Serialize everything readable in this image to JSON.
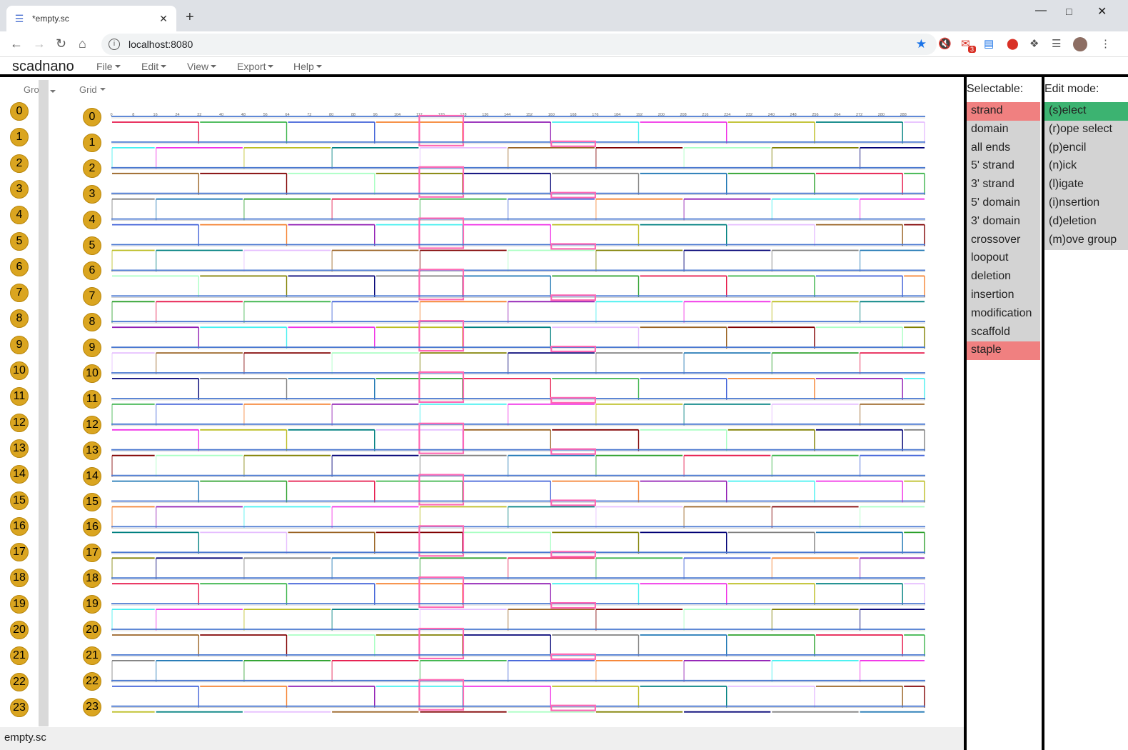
{
  "browser": {
    "tab_title": "*empty.sc",
    "url": "localhost:8080",
    "notif_count": "3"
  },
  "menubar": {
    "brand": "scadnano",
    "menus": [
      "File",
      "Edit",
      "View",
      "Export",
      "Help"
    ]
  },
  "sidebar_header": {
    "group": "Gro",
    "grid": "Grid"
  },
  "helix_indices": [
    "0",
    "1",
    "2",
    "3",
    "4",
    "5",
    "6",
    "7",
    "8",
    "9",
    "10",
    "11",
    "12",
    "13",
    "14",
    "15",
    "16",
    "17",
    "18",
    "19",
    "20",
    "21",
    "22",
    "23"
  ],
  "ruler_ticks": [
    "0",
    "8",
    "16",
    "24",
    "32",
    "40",
    "48",
    "56",
    "64",
    "72",
    "80",
    "88",
    "96",
    "104",
    "112",
    "120",
    "128",
    "136",
    "144",
    "152",
    "160",
    "168",
    "176",
    "184",
    "192",
    "200",
    "208",
    "216",
    "224",
    "232",
    "240",
    "248",
    "256",
    "264",
    "272",
    "280",
    "288"
  ],
  "selectable": {
    "header": "Selectable:",
    "options": [
      {
        "label": "strand",
        "selected": true
      },
      {
        "label": "domain",
        "selected": false
      },
      {
        "label": "all ends",
        "selected": false
      },
      {
        "label": "5' strand",
        "selected": false
      },
      {
        "label": "3' strand",
        "selected": false
      },
      {
        "label": "5' domain",
        "selected": false
      },
      {
        "label": "3' domain",
        "selected": false
      },
      {
        "label": "crossover",
        "selected": false
      },
      {
        "label": "loopout",
        "selected": false
      },
      {
        "label": "deletion",
        "selected": false
      },
      {
        "label": "insertion",
        "selected": false
      },
      {
        "label": "modification",
        "selected": false
      },
      {
        "label": "scaffold",
        "selected": false
      },
      {
        "label": "staple",
        "selected": true
      }
    ]
  },
  "edit_mode": {
    "header": "Edit mode:",
    "options": [
      {
        "label": "(s)elect",
        "selected": true
      },
      {
        "label": "(r)ope select",
        "selected": false
      },
      {
        "label": "(p)encil",
        "selected": false
      },
      {
        "label": "(n)ick",
        "selected": false
      },
      {
        "label": "(l)igate",
        "selected": false
      },
      {
        "label": "(i)nsertion",
        "selected": false
      },
      {
        "label": "(d)eletion",
        "selected": false
      },
      {
        "label": "(m)ove group",
        "selected": false
      }
    ]
  },
  "footer": {
    "filename": "empty.sc"
  },
  "colors": {
    "helix_circle": "#daa520",
    "scaffold": "#ff69b4",
    "selected_option": "#f08080",
    "active_mode": "#3cb371",
    "staple_palette": [
      "#e6194b",
      "#3cb44b",
      "#4363d8",
      "#f58231",
      "#911eb4",
      "#46f0f0",
      "#f032e6",
      "#bcbd22",
      "#008080",
      "#e6beff",
      "#9a6324",
      "#800000",
      "#aaffc3",
      "#808000",
      "#000075",
      "#808080",
      "#1f77b4",
      "#2ca02c"
    ]
  }
}
